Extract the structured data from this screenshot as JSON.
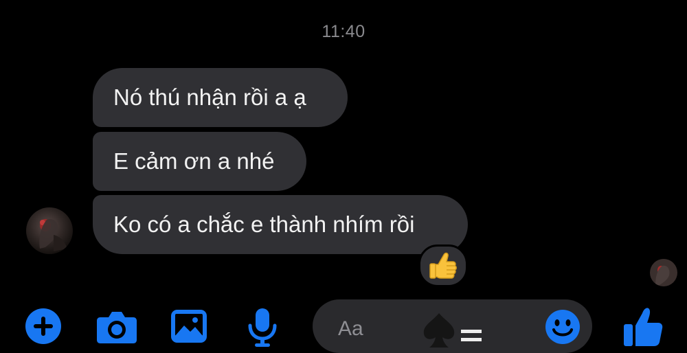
{
  "conversation": {
    "timestamp": "11:40",
    "messages": [
      {
        "text": "Nó thú nhận rồi a ạ"
      },
      {
        "text": "E cảm ơn a nhé"
      },
      {
        "text": "Ko có a chắc e thành nhím rồi"
      }
    ],
    "reaction": "thumbs-up-emoji",
    "seen_indicator": "seen-avatar"
  },
  "composer": {
    "placeholder": "Aa",
    "icons": [
      "plus-icon",
      "camera-icon",
      "image-icon",
      "microphone-icon",
      "emoji-icon",
      "like-icon"
    ]
  },
  "colors": {
    "background": "#000000",
    "bubble": "#303034",
    "accent": "#1877f2",
    "timestamp": "#8a8a8e"
  }
}
